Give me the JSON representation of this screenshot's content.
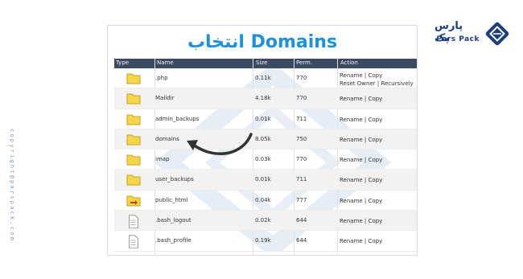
{
  "brand": {
    "name_fa": "پارس پک",
    "name_en": "Pars Pack",
    "vertical_text": "copyright@parspack.com",
    "accent": "#1e90e0",
    "brand_dark": "#1d3e7a"
  },
  "panel": {
    "title": "انتخاب Domains",
    "columns": {
      "type": "Type",
      "name": "Name",
      "size": "Size",
      "perm": "Perm.",
      "action": "Action"
    },
    "rows": [
      {
        "icon": "folder-icon",
        "name": ".php",
        "size": "0.11k",
        "perm": "770",
        "action_line1": "Rename | Copy",
        "action_line2": "Reset Owner | Recursively"
      },
      {
        "icon": "folder-icon",
        "name": "Maildir",
        "size": "4.18k",
        "perm": "770",
        "action_line1": "Rename | Copy"
      },
      {
        "icon": "folder-icon",
        "name": "admin_backups",
        "size": "0.01k",
        "perm": "711",
        "action_line1": "Rename | Copy"
      },
      {
        "icon": "folder-icon",
        "name": "domains",
        "size": "8.05k",
        "perm": "750",
        "action_line1": "Rename | Copy"
      },
      {
        "icon": "folder-icon",
        "name": "imap",
        "size": "0.03k",
        "perm": "770",
        "action_line1": "Rename | Copy"
      },
      {
        "icon": "folder-icon",
        "name": "user_backups",
        "size": "0.01k",
        "perm": "711",
        "action_line1": "Rename | Copy"
      },
      {
        "icon": "folder-link-icon",
        "name": "public_html",
        "size": "0.04k",
        "perm": "777",
        "action_line1": "Rename | Copy"
      },
      {
        "icon": "file-icon",
        "name": ".bash_logout",
        "size": "0.02k",
        "perm": "644",
        "action_line1": "Rename | Copy"
      },
      {
        "icon": "file-icon",
        "name": ".bash_profile",
        "size": "0.19k",
        "perm": "644",
        "action_line1": "Rename | Copy"
      }
    ]
  }
}
